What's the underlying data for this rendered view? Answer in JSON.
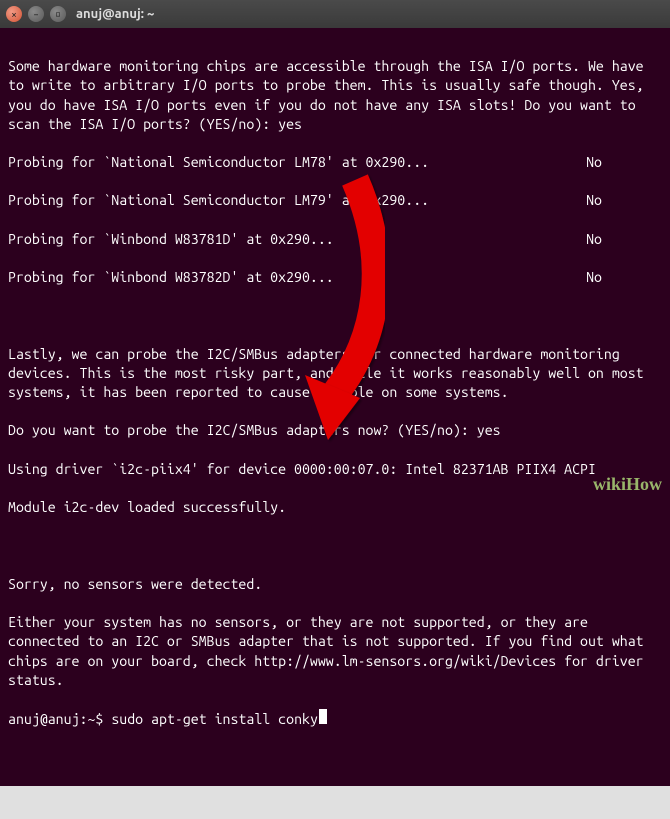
{
  "window": {
    "title": "anuj@anuj: ~",
    "close_glyph": "×",
    "min_glyph": "–",
    "max_glyph": "▫"
  },
  "output": {
    "para1": "Some hardware monitoring chips are accessible through the ISA I/O ports. We have to write to arbitrary I/O ports to probe them. This is usually safe though. Yes, you do have ISA I/O ports even if you do not have any ISA slots! Do you want to scan the ISA I/O ports? (YES/no): yes",
    "probes": [
      {
        "text": "Probing for `National Semiconductor LM78' at 0x290...",
        "answer": "No"
      },
      {
        "text": "Probing for `National Semiconductor LM79' at 0x290...",
        "answer": "No"
      },
      {
        "text": "Probing for `Winbond W83781D' at 0x290...",
        "answer": "No"
      },
      {
        "text": "Probing for `Winbond W83782D' at 0x290...",
        "answer": "No"
      }
    ],
    "para2": "Lastly, we can probe the I2C/SMBus adapters for connected hardware monitoring devices. This is the most risky part, and while it works reasonably well on most systems, it has been reported to cause trouble on some systems.",
    "q2": "Do you want to probe the I2C/SMBus adapters now? (YES/no): yes",
    "driver": "Using driver `i2c-piix4' for device 0000:00:07.0: Intel 82371AB PIIX4 ACPI",
    "module": "Module i2c-dev loaded successfully.",
    "sorry": "Sorry, no sensors were detected.",
    "either": "Either your system has no sensors, or they are not supported, or they are connected to an I2C or SMBus adapter that is not supported. If you find out what chips are on your board, check http://www.lm-sensors.org/wiki/Devices for driver status."
  },
  "prompt": {
    "user_host": "anuj@anuj",
    "sep1": ":",
    "path": "~",
    "sep2": "$",
    "command": " sudo apt-get install conky"
  },
  "watermark": "wikiHow"
}
